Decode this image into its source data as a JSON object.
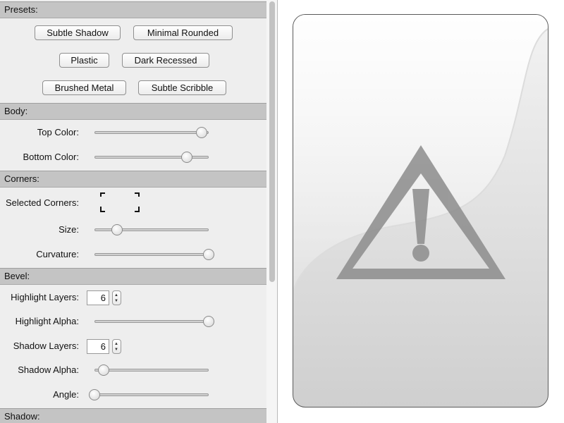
{
  "sections": {
    "presets": "Presets:",
    "body": "Body:",
    "corners": "Corners:",
    "bevel": "Bevel:",
    "shadow": "Shadow:"
  },
  "presets": {
    "subtle_shadow": "Subtle Shadow",
    "minimal_rounded": "Minimal Rounded",
    "plastic": "Plastic",
    "dark_recessed": "Dark Recessed",
    "brushed_metal": "Brushed Metal",
    "subtle_scribble": "Subtle Scribble"
  },
  "body": {
    "top_color_label": "Top Color:",
    "top_color_value": 0.94,
    "bottom_color_label": "Bottom Color:",
    "bottom_color_value": 0.81
  },
  "corners": {
    "selected_corners_label": "Selected Corners:",
    "selected": [
      "top-left",
      "top-right",
      "bottom-left",
      "bottom-right"
    ],
    "size_label": "Size:",
    "size_value": 0.2,
    "curvature_label": "Curvature:",
    "curvature_value": 1.0
  },
  "bevel": {
    "highlight_layers_label": "Highlight Layers:",
    "highlight_layers": "6",
    "highlight_alpha_label": "Highlight Alpha:",
    "highlight_alpha_value": 1.0,
    "shadow_layers_label": "Shadow Layers:",
    "shadow_layers": "6",
    "shadow_alpha_label": "Shadow Alpha:",
    "shadow_alpha_value": 0.08,
    "angle_label": "Angle:",
    "angle_value": 0.0
  },
  "preview": {
    "icon": "warning-icon"
  }
}
